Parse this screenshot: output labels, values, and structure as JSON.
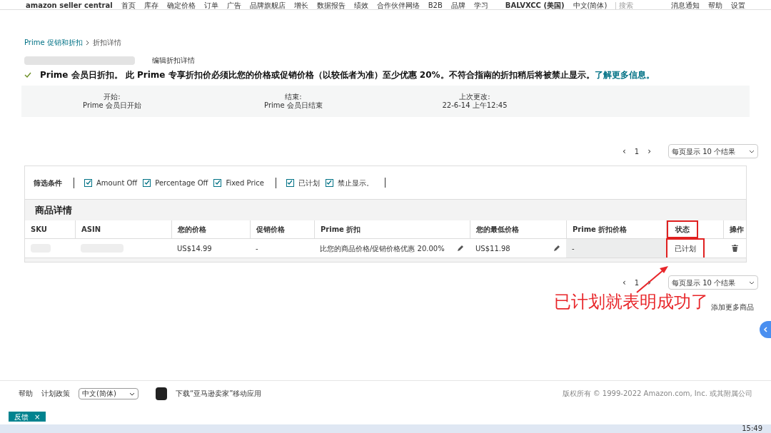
{
  "top_nav": {
    "logo": "amazon seller central",
    "items": [
      "首页",
      "库存",
      "确定价格",
      "订单",
      "广告",
      "品牌旗舰店",
      "增长",
      "数据报告",
      "绩效",
      "合作伙伴网络",
      "B2B",
      "品牌",
      "学习"
    ],
    "store": "BALVXCC (美国)",
    "language": "中文(简体)",
    "search_placeholder": "搜索",
    "links": [
      "消息通知",
      "帮助",
      "设置"
    ]
  },
  "breadcrumb": [
    "Prime 促销和折扣",
    "折扣详情"
  ],
  "edit_link": "编辑折扣详情",
  "notice": {
    "text": "Prime 会员日折扣。 此 Prime 专享折扣价必须比您的价格或促销价格（以较低者为准）至少优惠 20%。不符合指南的折扣稍后将被禁止显示。",
    "link": "了解更多信息。"
  },
  "summary": [
    {
      "label": "开始:",
      "value": "Prime 会员日开始"
    },
    {
      "label": "结束:",
      "value": "Prime 会员日结束"
    },
    {
      "label": "上次更改:",
      "value": "22-6-14 上午12:45"
    }
  ],
  "pagination_top": {
    "prev": "‹",
    "page": "1",
    "next": "›",
    "per_page": "每页显示 10 个结果"
  },
  "filters": {
    "label": "筛选条件",
    "groups": [
      [
        {
          "label": "Amount Off",
          "checked": true
        },
        {
          "label": "Percentage Off",
          "checked": true
        },
        {
          "label": "Fixed Price",
          "checked": true
        }
      ],
      [
        {
          "label": "已计划",
          "checked": true
        },
        {
          "label": "禁止显示。",
          "checked": true
        }
      ]
    ]
  },
  "table": {
    "title": "商品详情",
    "columns": [
      {
        "label": "SKU",
        "highlighted": false
      },
      {
        "label": "ASIN",
        "highlighted": false
      },
      {
        "label": "您的价格",
        "highlighted": false
      },
      {
        "label": "促销价格",
        "highlighted": false
      },
      {
        "label": "Prime 折扣",
        "highlighted": false
      },
      {
        "label": "您的最低价格",
        "highlighted": false
      },
      {
        "label": "Prime 折扣价格",
        "highlighted": false
      },
      {
        "label": "状态",
        "highlighted": true
      },
      {
        "label": "操作",
        "highlighted": false
      }
    ],
    "rows": [
      {
        "your_price": "US$14.99",
        "promo_price": "-",
        "prime_discount": "比您的商品价格/促销价格优惠 20.00%",
        "min_price": "US$11.98",
        "prime_price": "-",
        "status": "已计划"
      }
    ]
  },
  "pagination_bottom": {
    "prev": "‹",
    "page": "1",
    "next": "›",
    "per_page": "每页显示 10 个结果"
  },
  "annotation": "已计划就表明成功了",
  "add_more_link": "添加更多商品",
  "footer": {
    "links": [
      "帮助",
      "计划政策"
    ],
    "language": "中文(简体)",
    "app_download": "下载“亚马逊卖家”移动应用",
    "copyright": "版权所有 © 1999-2022 Amazon.com, Inc. 或其附属公司"
  },
  "feedback": {
    "label": "反馈",
    "close": "×"
  },
  "taskbar": {
    "time": "15:49"
  }
}
